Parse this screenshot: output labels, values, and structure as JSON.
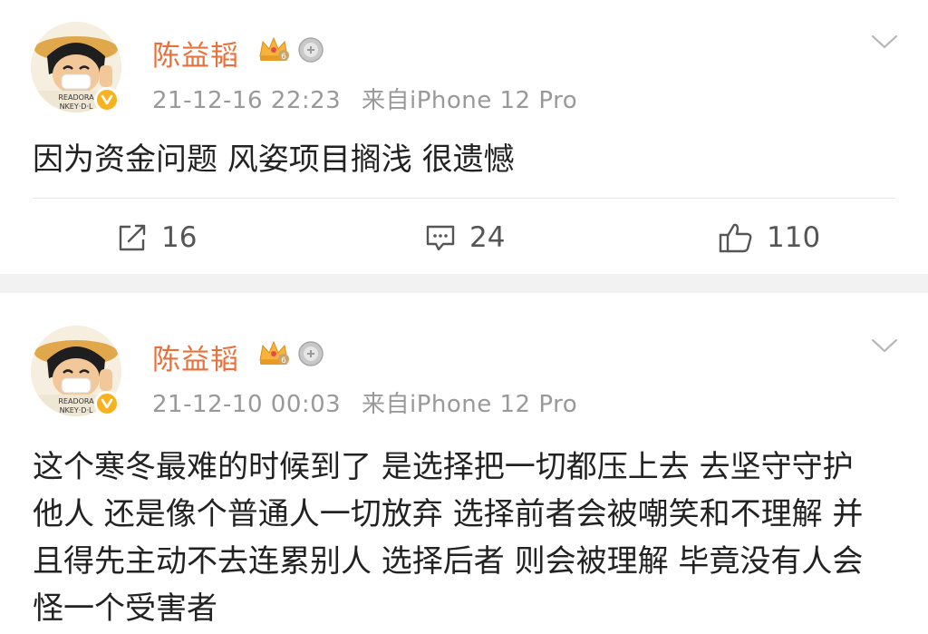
{
  "posts": [
    {
      "author": "陈益韬",
      "timestamp": "21-12-16 22:23",
      "source": "来自iPhone 12 Pro",
      "content": "因为资金问题 风姿项目搁浅 很遗憾",
      "actions": {
        "repost": "16",
        "comment": "24",
        "like": "110"
      }
    },
    {
      "author": "陈益韬",
      "timestamp": "21-12-10 00:03",
      "source": "来自iPhone 12 Pro",
      "content": "这个寒冬最难的时候到了 是选择把一切都压上去 去坚守守护他人 还是像个普通人一切放弃 选择前者会被嘲笑和不理解 并且得先主动不去连累别人 选择后者 则会被理解 毕竟没有人会怪一个受害者"
    }
  ],
  "badges": {
    "crown_level": "6"
  },
  "avatar_text": {
    "line1": "READORA",
    "line2": "NKEY·D·L"
  },
  "icons": {
    "avatar": "cartoon-pirate-avatar",
    "verified": "verified-badge-icon",
    "crown": "vip-crown-icon",
    "medal": "medal-icon",
    "chevron": "chevron-down-icon",
    "repost": "repost-icon",
    "comment": "comment-icon",
    "like": "thumbs-up-icon"
  },
  "colors": {
    "author": "#e8703a",
    "verified": "#f7b21e",
    "meta": "#999999",
    "background": "#f2f2f2"
  }
}
